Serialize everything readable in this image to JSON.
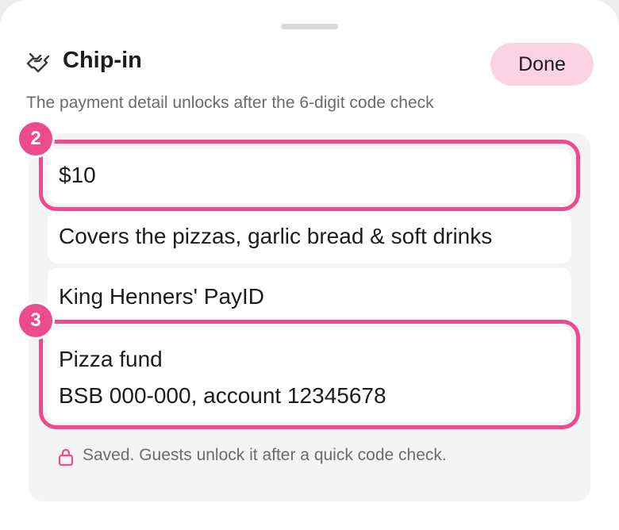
{
  "sheet": {
    "title": "Chip-in",
    "title_icon": "handshake-icon",
    "done_label": "Done",
    "subtitle": "The payment detail unlocks after the 6-digit code check"
  },
  "fields": {
    "amount": "$10",
    "description": "Covers the pizzas, garlic bread & soft drinks",
    "payee": "King Henners' PayID",
    "account_name": "Pizza fund",
    "account_details": "BSB 000-000, account 12345678"
  },
  "badges": {
    "amount": "2",
    "account": "3"
  },
  "footer": {
    "lock_icon": "lock-icon",
    "note": "Saved. Guests unlock it after a quick code check."
  },
  "colors": {
    "accent": "#ec4b8e",
    "done_button_bg": "#fbd3e2",
    "panel_bg": "#f4f4f4",
    "muted_text": "#6b6b6b"
  }
}
